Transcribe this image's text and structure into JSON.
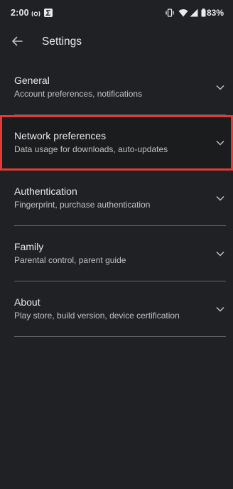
{
  "status_bar": {
    "time": "2:00",
    "battery": "83%"
  },
  "app_bar": {
    "title": "Settings"
  },
  "settings": [
    {
      "title": "General",
      "subtitle": "Account preferences, notifications"
    },
    {
      "title": "Network preferences",
      "subtitle": "Data usage for downloads, auto-updates",
      "highlighted": true
    },
    {
      "title": "Authentication",
      "subtitle": "Fingerprint, purchase authentication"
    },
    {
      "title": "Family",
      "subtitle": "Parental control, parent guide"
    },
    {
      "title": "About",
      "subtitle": "Play store, build version, device certification"
    }
  ],
  "colors": {
    "background": "#202124",
    "text_primary": "#e8eaed",
    "text_secondary": "#bdc1c6",
    "divider": "#5f6368",
    "highlight": "#e53935"
  },
  "icons": [
    "back-arrow",
    "chevron-down",
    "vpn-key",
    "sigma",
    "vibrate",
    "wifi",
    "signal",
    "battery"
  ]
}
